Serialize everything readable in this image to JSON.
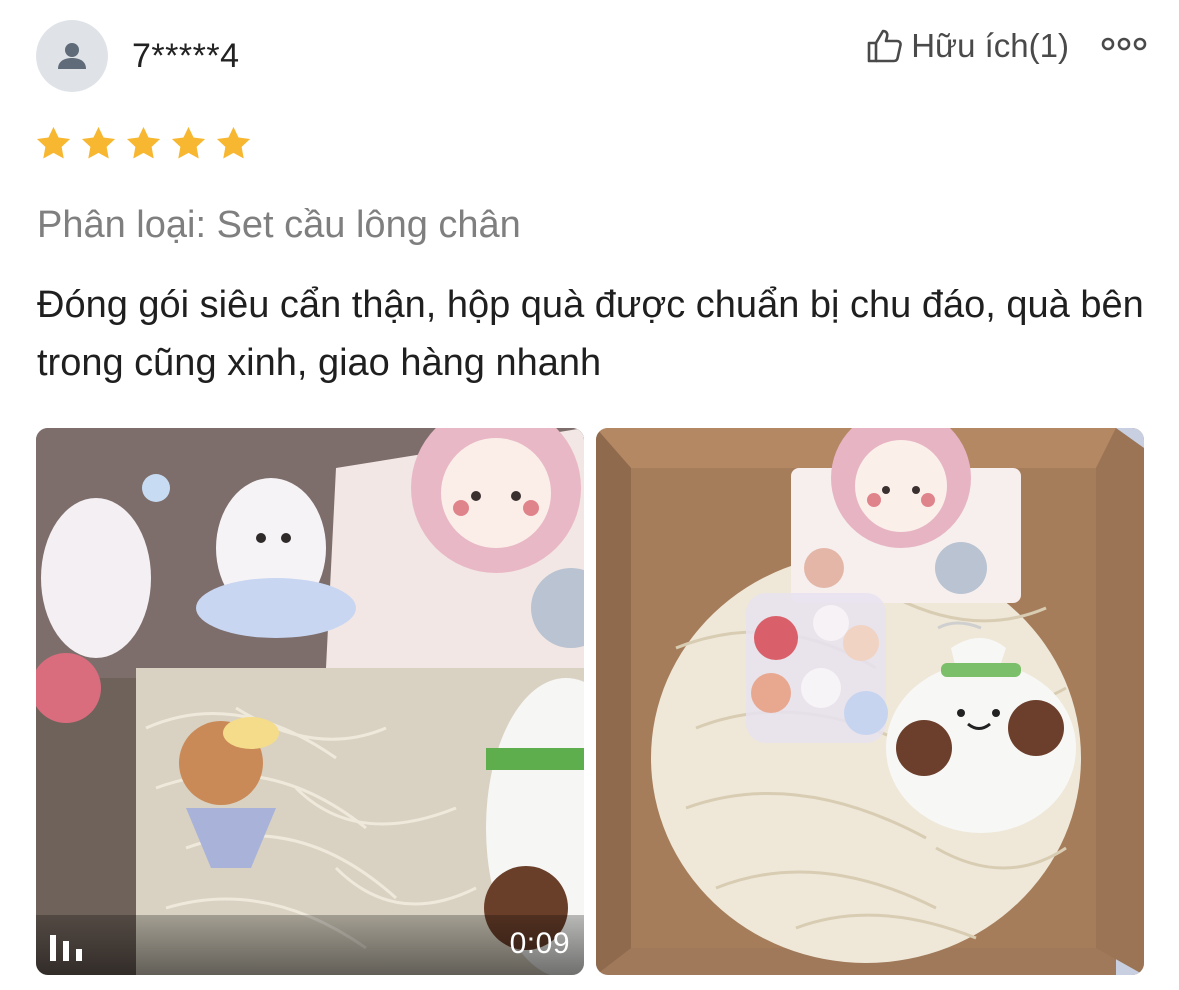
{
  "review": {
    "username": "7*****4",
    "helpful_label": "Hữu ích(1)",
    "rating": 5,
    "variant": "Phân loại: Set cầu lông chân",
    "text": "Đóng gói siêu cẩn thận, hộp quà được chuẩn bị chu đáo, quà bên trong cũng xinh, giao hàng nhanh",
    "media": [
      {
        "type": "video",
        "duration": "0:09"
      },
      {
        "type": "image"
      }
    ]
  },
  "icons": {
    "avatar": "user-icon",
    "helpful": "thumbs-up-icon",
    "more": "more-options-icon",
    "star": "star-icon",
    "video": "video-indicator-icon"
  },
  "colors": {
    "star": "#f7b731",
    "secondary_text": "#7f7f7f",
    "avatar_bg": "#dfe3e8"
  }
}
